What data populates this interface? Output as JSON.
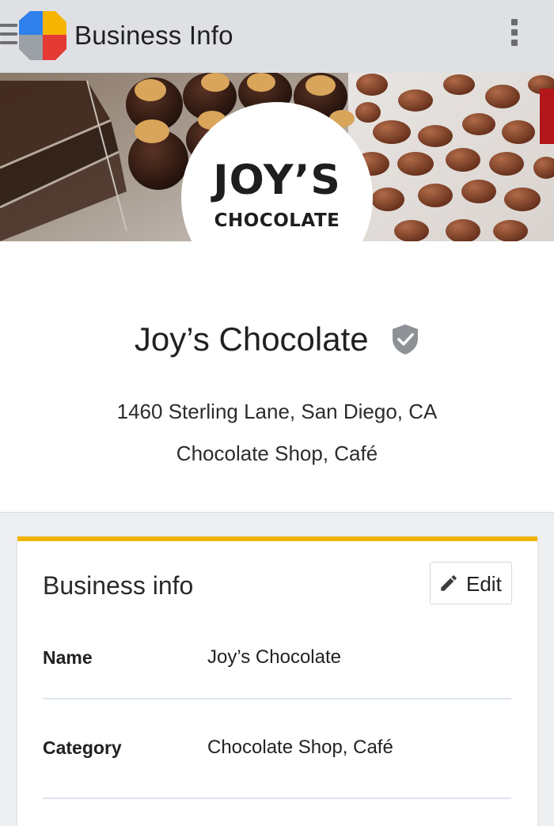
{
  "app_bar": {
    "title": "Business Info",
    "icons": {
      "menu": "menu-icon",
      "logo": "google-my-business-logo",
      "more": "more-vert-icon"
    },
    "logo_colors": [
      "#2f80ed",
      "#f6b400",
      "#e53935",
      "#9aa0a6"
    ]
  },
  "cover": {
    "brand_name_line1": "JOY’S",
    "brand_name_line2": "CHOCOLATE"
  },
  "business": {
    "name": "Joy’s Chocolate",
    "verified_icon": "verified-shield-icon",
    "address": "1460 Sterling Lane, San Diego, CA",
    "categories": "Chocolate Shop, Café"
  },
  "info_card": {
    "accent_color": "#f0b400",
    "title": "Business info",
    "edit_label": "Edit",
    "edit_icon": "pencil-icon",
    "rows": [
      {
        "label": "Name",
        "value": "Joy’s Chocolate"
      },
      {
        "label": "Category",
        "value": "Chocolate Shop, Café"
      }
    ]
  }
}
